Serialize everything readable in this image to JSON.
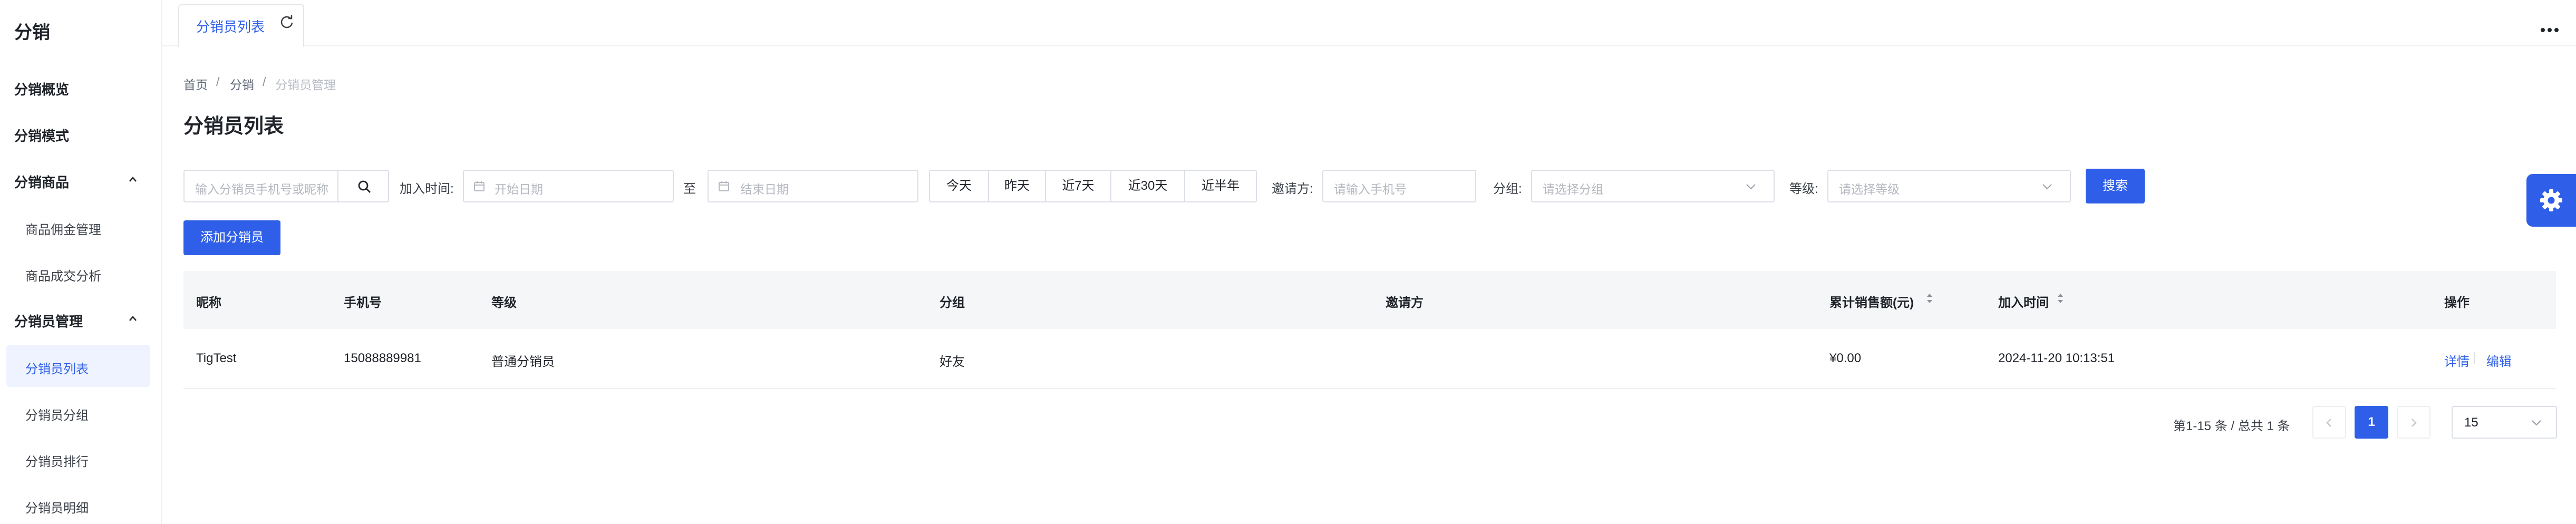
{
  "sidebar": {
    "title": "分销",
    "items": [
      {
        "label": "分销概览"
      },
      {
        "label": "分销模式"
      },
      {
        "label": "分销商品"
      },
      {
        "label": "商品佣金管理"
      },
      {
        "label": "商品成交分析"
      },
      {
        "label": "分销员管理"
      },
      {
        "label": "分销员列表"
      },
      {
        "label": "分销员分组"
      },
      {
        "label": "分销员排行"
      },
      {
        "label": "分销员明细"
      }
    ]
  },
  "tabs": [
    {
      "label": "分销员列表"
    }
  ],
  "breadcrumb": [
    "首页",
    "分销",
    "分销员管理"
  ],
  "page_title": "分销员列表",
  "filters": {
    "search_placeholder": "输入分销员手机号或昵称",
    "join_time_label": "加入时间:",
    "start_placeholder": "开始日期",
    "range_sep": "至",
    "end_placeholder": "结束日期",
    "quick_ranges": [
      "今天",
      "昨天",
      "近7天",
      "近30天",
      "近半年"
    ],
    "inviter_label": "邀请方:",
    "inviter_placeholder": "请输入手机号",
    "group_label": "分组:",
    "group_placeholder": "请选择分组",
    "level_label": "等级:",
    "level_placeholder": "请选择等级",
    "search_button": "搜索"
  },
  "add_button": "添加分销员",
  "table": {
    "columns": [
      "昵称",
      "手机号",
      "等级",
      "分组",
      "邀请方",
      "累计销售额(元)",
      "加入时间",
      "操作"
    ],
    "rows": [
      {
        "nickname": "TigTest",
        "phone": "15088889981",
        "level": "普通分销员",
        "group": "好友",
        "inviter": "",
        "sales": "¥0.00",
        "joined": "2024-11-20 10:13:51",
        "action_detail": "详情",
        "action_edit": "编辑"
      }
    ]
  },
  "pagination": {
    "summary": "第1-15 条 / 总共 1 条",
    "current_page": "1",
    "page_size": "15"
  },
  "colors": {
    "primary": "#2f5fe8",
    "header_bg": "#f5f6f8"
  }
}
